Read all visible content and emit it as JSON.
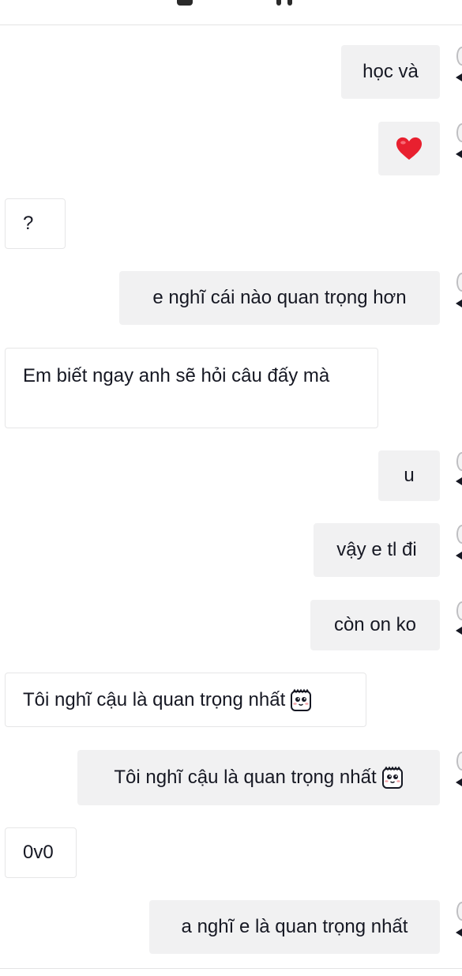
{
  "messages": [
    {
      "side": "sent",
      "text": "học và"
    },
    {
      "side": "sent",
      "icon": "red-heart-emoji-icon"
    },
    {
      "side": "received",
      "text": "?"
    },
    {
      "side": "sent",
      "text": "e nghĩ cái nào quan trọng hơn"
    },
    {
      "side": "received",
      "text": "Em biết ngay anh sẽ hỏi câu đấy mà"
    },
    {
      "side": "sent",
      "text": "u"
    },
    {
      "side": "sent",
      "text": "vậy e tl đi"
    },
    {
      "side": "sent",
      "text": "còn on ko"
    },
    {
      "side": "received",
      "text": "Tôi nghĩ cậu là quan trọng nhất",
      "icon": "cute-face-sticker-icon"
    },
    {
      "side": "sent",
      "text": "Tôi nghĩ cậu là quan trọng nhất",
      "icon": "cute-face-sticker-icon"
    },
    {
      "side": "received",
      "text": "0v0"
    },
    {
      "side": "sent",
      "text": "a nghĩ e là quan trọng nhất"
    }
  ],
  "colors": {
    "sent_bubble": "#f1f1f2",
    "received_border": "#e6e6e7",
    "text": "#161823",
    "heart": "#e8202f",
    "divider": "#e3e3e4"
  }
}
